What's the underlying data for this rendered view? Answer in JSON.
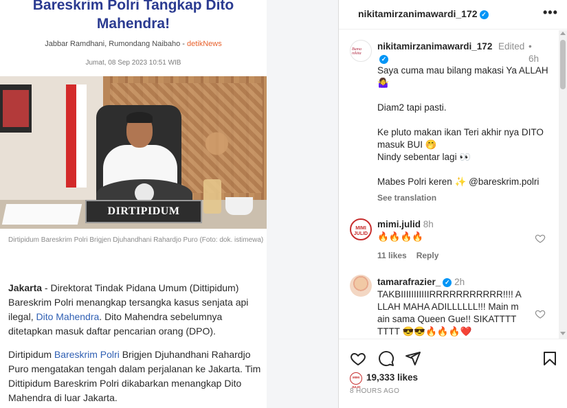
{
  "article": {
    "headline": "Bareskrim Polri Tangkap Dito Mahendra!",
    "byline_authors": "Jabbar Ramdhani, Rumondang Naibaho - ",
    "byline_source": "detikNews",
    "date": "Jumat, 08 Sep 2023 10:51 WIB",
    "photo_plaque": "DIRTIPIDUM",
    "photo_caption": "Dirtipidum Bareskrim Polri Brigjen Djuhandhani Rahardjo Puro (Foto: dok. istimewa)",
    "para1_lead": "Jakarta",
    "para1_a": " - Direktorat Tindak Pidana Umum (Dittipidum) Bareskrim Polri menangkap tersangka kasus senjata api ilegal, ",
    "para1_link": "Dito Mahendra",
    "para1_b": ". Dito Mahendra sebelumnya ditetapkan masuk daftar pencarian orang (DPO).",
    "para2_a": "Dirtipidum ",
    "para2_link": "Bareskrim Polri",
    "para2_b": " Brigjen Djuhandhani Rahardjo Puro mengatakan tengah dalam perjalanan ke Jakarta. Tim Dittipidum Bareskrim Polri dikabarkan menangkap Dito Mahendra di luar Jakarta."
  },
  "header": {
    "username": "nikitamirzanimawardi_172",
    "more_label": "•••"
  },
  "owner_comment": {
    "avatar_text": "Buma nikita",
    "username": "nikitamirzanimawardi_172",
    "edited": "Edited",
    "separator": "•",
    "time": "6h",
    "lines": [
      "Saya cuma mau bilang makasi Ya ALLAH 🤷‍♀️",
      "",
      "Diam2 tapi pasti.",
      "",
      "Ke pluto makan ikan Teri akhir nya DITO masuk BUI 🤭",
      "Nindy sebentar lagi 👀",
      "",
      "Mabes Polri keren ✨ @bareskrim.polri"
    ],
    "see_translation": "See translation"
  },
  "comments": [
    {
      "avatar_text": "MIMI JULID",
      "username": "mimi.julid",
      "time": "8h",
      "text": "🔥🔥🔥🔥",
      "likes": "11 likes",
      "reply": "Reply"
    },
    {
      "username": "tamarafrazier_",
      "time": "2h",
      "text": "TAKBIIIIIIIIIIIRRRRRRRRRRR!!!! ALLAH MAHA ADILLLLLL!!! Main main sama Queen Gue!! SIKATTTTTTTT 😎😎🔥🔥🔥❤️"
    }
  ],
  "actions": {
    "likes_avatar_text": "MIMI JULID",
    "likes": "19,333 likes",
    "posted": "8 HOURS AGO"
  },
  "colors": {
    "headline": "#2b3b91",
    "link": "#2f5fb3",
    "source": "#e8612c",
    "verified": "#0095f6"
  }
}
